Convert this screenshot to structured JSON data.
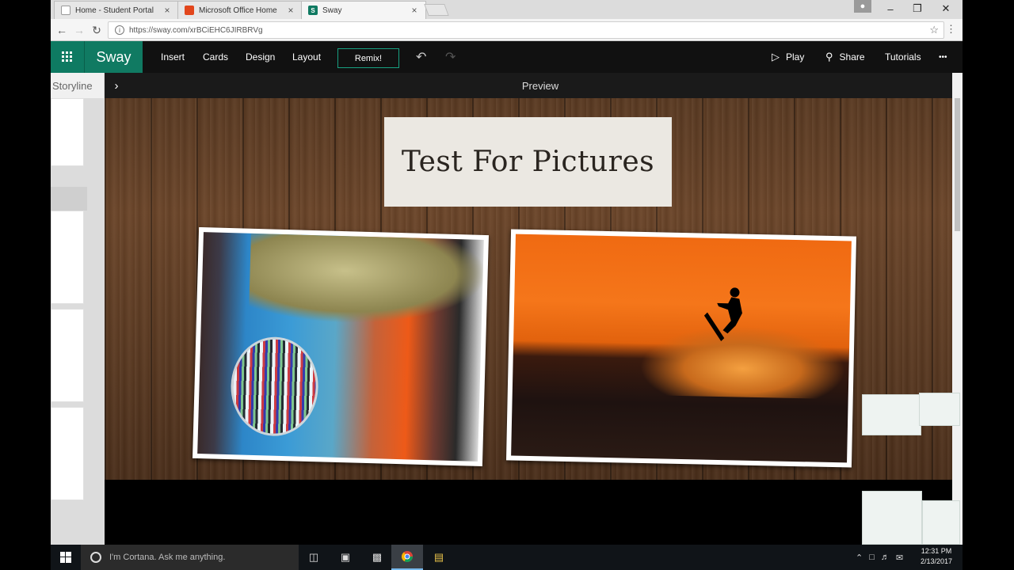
{
  "browser": {
    "tabs": [
      {
        "title": "Home - Student Portal",
        "close": "×"
      },
      {
        "title": "Microsoft Office Home",
        "close": "×"
      },
      {
        "title": "Sway",
        "close": "×"
      }
    ],
    "url": "https://sway.com/xrBCiEHC6JIRBRVg",
    "window_controls": {
      "minimize": "–",
      "restore": "❐",
      "close": "✕"
    }
  },
  "sway": {
    "brand": "Sway",
    "menu": [
      "Insert",
      "Cards",
      "Design",
      "Layout"
    ],
    "remix": "Remix!",
    "right_menu": {
      "play": "Play",
      "share": "Share",
      "tutorials": "Tutorials",
      "more": "•••"
    },
    "storyline": "Storyline",
    "preview": "Preview",
    "title": "Test For Pictures"
  },
  "taskbar": {
    "cortana": "I'm Cortana. Ask me anything.",
    "time": "12:31 PM",
    "date": "2/13/2017"
  },
  "colors": {
    "sway_green": "#107a62",
    "toolbar": "#111111",
    "taskbar": "#101418"
  }
}
